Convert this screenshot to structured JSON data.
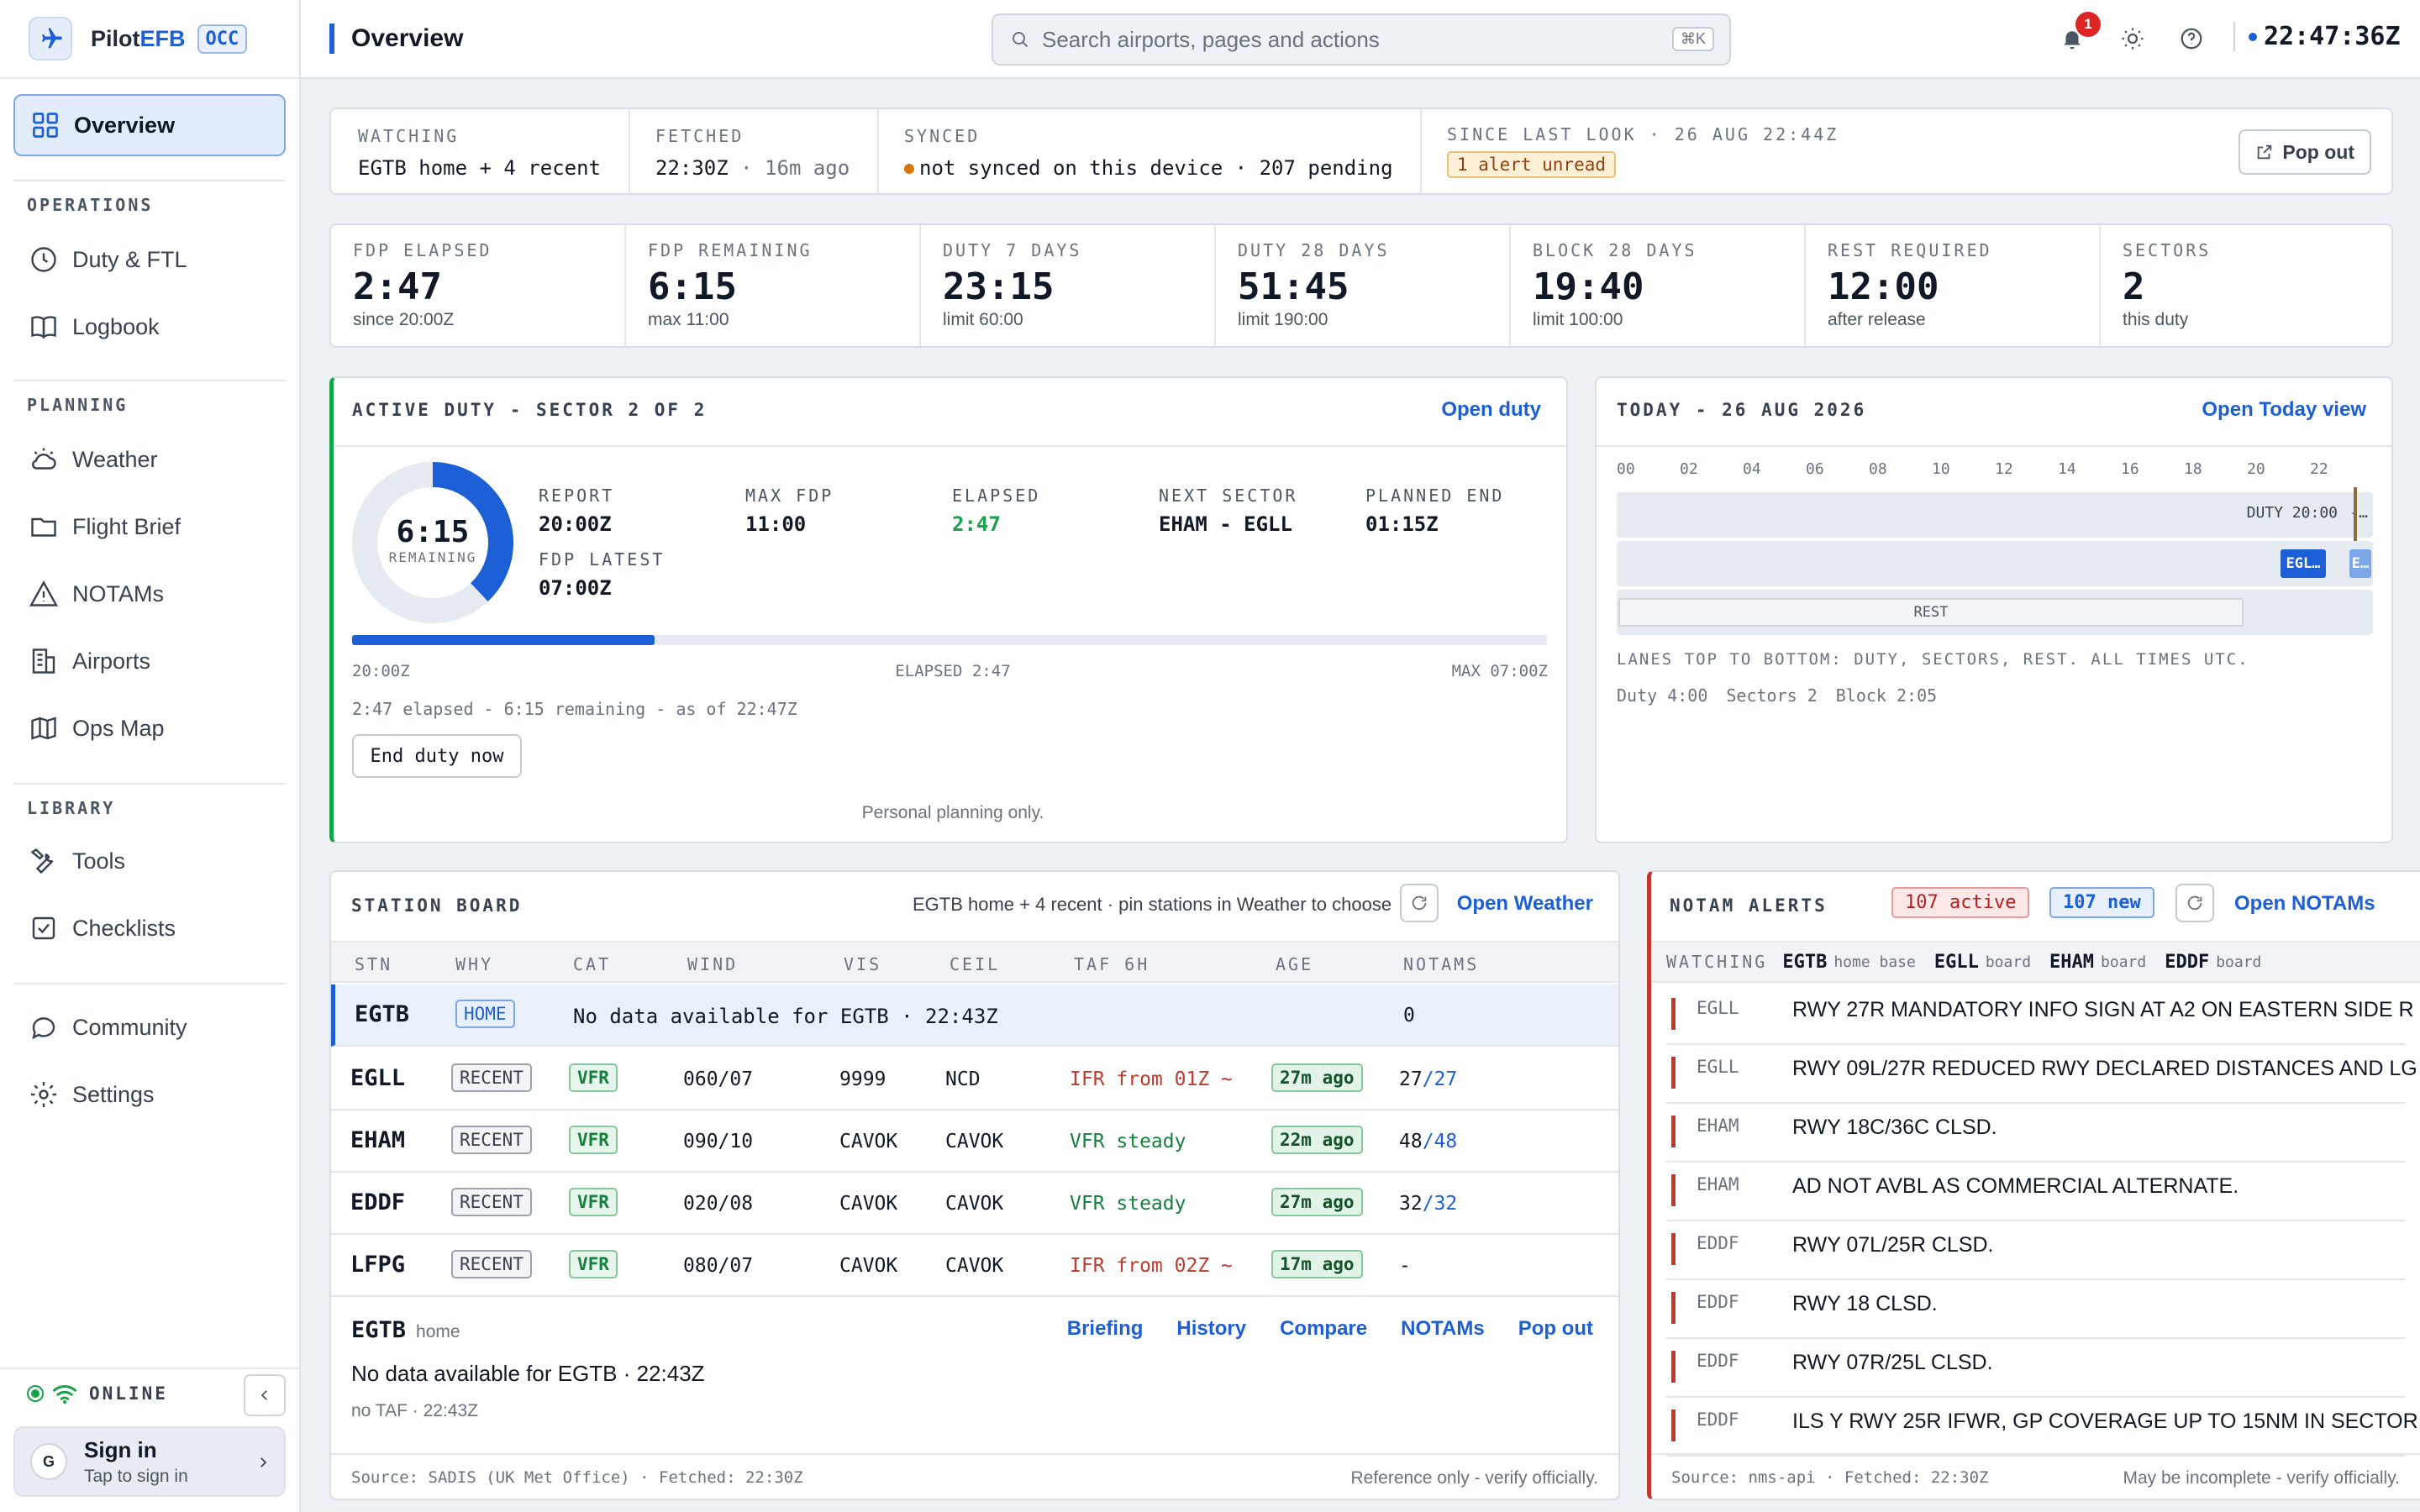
{
  "brand": {
    "name_prefix": "Pilot",
    "name_suffix": "EFB",
    "badge": "OCC"
  },
  "sidebar": {
    "overview": "Overview",
    "sections": {
      "operations": "OPERATIONS",
      "planning": "PLANNING",
      "library": "LIBRARY"
    },
    "items": {
      "duty": "Duty & FTL",
      "logbook": "Logbook",
      "weather": "Weather",
      "flight_brief": "Flight Brief",
      "notams": "NOTAMs",
      "airports": "Airports",
      "ops_map": "Ops Map",
      "tools": "Tools",
      "checklists": "Checklists",
      "community": "Community",
      "settings": "Settings"
    },
    "status": "ONLINE",
    "signin": {
      "avatar": "G",
      "title": "Sign in",
      "subtitle": "Tap to sign in"
    }
  },
  "header": {
    "title": "Overview",
    "search_placeholder": "Search airports, pages and actions",
    "shortcut": "⌘K",
    "notification_count": "1",
    "clock": "22:47:36Z"
  },
  "status_strip": {
    "watching_label": "WATCHING",
    "watching_value": "EGTB home + 4 recent",
    "fetched_label": "FETCHED",
    "fetched_value": "22:30Z",
    "fetched_ago": "· 16m ago",
    "synced_label": "SYNCED",
    "synced_value": "not synced on this device · 207 pending",
    "since_label": "SINCE LAST LOOK · 26 AUG 22:44Z",
    "since_alert": "1 alert unread",
    "popout": "Pop out"
  },
  "metrics": [
    {
      "label": "FDP ELAPSED",
      "value": "2:47",
      "sub": "since 20:00Z"
    },
    {
      "label": "FDP REMAINING",
      "value": "6:15",
      "sub": "max 11:00"
    },
    {
      "label": "DUTY 7 DAYS",
      "value": "23:15",
      "sub": "limit 60:00"
    },
    {
      "label": "DUTY 28 DAYS",
      "value": "51:45",
      "sub": "limit 190:00"
    },
    {
      "label": "BLOCK 28 DAYS",
      "value": "19:40",
      "sub": "limit 100:00"
    },
    {
      "label": "REST REQUIRED",
      "value": "12:00",
      "sub": "after release"
    },
    {
      "label": "SECTORS",
      "value": "2",
      "sub": "this duty"
    }
  ],
  "active_duty": {
    "title": "ACTIVE DUTY - SECTOR 2 OF 2",
    "link": "Open duty",
    "donut_value": "6:15",
    "donut_label": "REMAINING",
    "donut_fraction": 0.38,
    "report_label": "REPORT",
    "report": "20:00Z",
    "max_fdp_label": "MAX FDP",
    "max_fdp": "11:00",
    "elapsed_label": "ELAPSED",
    "elapsed": "2:47",
    "next_label": "NEXT SECTOR",
    "next": "EHAM - EGLL",
    "planned_end_label": "PLANNED END",
    "planned_end": "01:15Z",
    "fdp_latest_label": "FDP LATEST",
    "fdp_latest": "07:00Z",
    "progress_fraction": 0.253,
    "bar_start": "20:00Z",
    "bar_mid": "ELAPSED 2:47",
    "bar_end": "MAX 07:00Z",
    "summary": "2:47 elapsed - 6:15 remaining - as of 22:47Z",
    "end_button": "End duty now",
    "note": "Personal planning only."
  },
  "today": {
    "title": "TODAY - 26 AUG 2026",
    "link": "Open Today view",
    "hours": [
      "00",
      "02",
      "04",
      "06",
      "08",
      "10",
      "12",
      "14",
      "16",
      "18",
      "20",
      "22"
    ],
    "duty_label": "DUTY 20:00",
    "duty_more": "-…",
    "sector1": "EGL…",
    "sector2": "E…",
    "rest_label": "REST",
    "caption": "LANES TOP TO BOTTOM: DUTY, SECTORS, REST. ALL TIMES UTC.",
    "summary_duty": "Duty 4:00",
    "summary_sectors": "Sectors 2",
    "summary_block": "Block 2:05"
  },
  "station_board": {
    "title": "STATION BOARD",
    "hint": "EGTB home + 4 recent · pin stations in Weather to choose",
    "link": "Open Weather",
    "columns": [
      "STN",
      "WHY",
      "CAT",
      "WIND",
      "VIS",
      "CEIL",
      "TAF 6H",
      "AGE",
      "NOTAMS"
    ],
    "home_row": {
      "stn": "EGTB",
      "why": "HOME",
      "message": "No data available for EGTB · 22:43Z",
      "notams": "0"
    },
    "rows": [
      {
        "stn": "EGLL",
        "why": "RECENT",
        "cat": "VFR",
        "wind": "060/07",
        "vis": "9999",
        "ceil": "NCD",
        "taf": "IFR from 01Z ~",
        "taf_color": "#c0392b",
        "age": "27m ago",
        "notams_a": "27",
        "notams_b": "/27"
      },
      {
        "stn": "EHAM",
        "why": "RECENT",
        "cat": "VFR",
        "wind": "090/10",
        "vis": "CAVOK",
        "ceil": "CAVOK",
        "taf": "VFR steady",
        "taf_color": "#15803d",
        "age": "22m ago",
        "notams_a": "48",
        "notams_b": "/48"
      },
      {
        "stn": "EDDF",
        "why": "RECENT",
        "cat": "VFR",
        "wind": "020/08",
        "vis": "CAVOK",
        "ceil": "CAVOK",
        "taf": "VFR steady",
        "taf_color": "#15803d",
        "age": "27m ago",
        "notams_a": "32",
        "notams_b": "/32"
      },
      {
        "stn": "LFPG",
        "why": "RECENT",
        "cat": "VFR",
        "wind": "080/07",
        "vis": "CAVOK",
        "ceil": "CAVOK",
        "taf": "IFR from 02Z ~",
        "taf_color": "#c0392b",
        "age": "17m ago",
        "notams_a": "-",
        "notams_b": ""
      }
    ],
    "detail": {
      "stn": "EGTB",
      "role": "home",
      "links": [
        "Briefing",
        "History",
        "Compare",
        "NOTAMs",
        "Pop out"
      ],
      "message": "No data available for EGTB · 22:43Z",
      "taf": "no TAF · 22:43Z"
    },
    "footer_left": "Source: SADIS (UK Met Office) · Fetched: 22:30Z",
    "footer_right": "Reference only - verify officially."
  },
  "notam_alerts": {
    "title": "NOTAM ALERTS",
    "active": "107 active",
    "new": "107 new",
    "link": "Open NOTAMs",
    "watching_label": "WATCHING",
    "watching": [
      {
        "code": "EGTB",
        "role": "home base"
      },
      {
        "code": "EGLL",
        "role": "board"
      },
      {
        "code": "EHAM",
        "role": "board"
      },
      {
        "code": "EDDF",
        "role": "board"
      }
    ],
    "items": [
      {
        "icao": "EGLL",
        "text": "RWY 27R MANDATORY INFO SIGN AT A2 ON EASTERN SIDE R"
      },
      {
        "icao": "EGLL",
        "text": "RWY 09L/27R REDUCED RWY DECLARED DISTANCES AND LG"
      },
      {
        "icao": "EHAM",
        "text": "RWY 18C/36C CLSD."
      },
      {
        "icao": "EHAM",
        "text": "AD NOT AVBL AS COMMERCIAL ALTERNATE."
      },
      {
        "icao": "EDDF",
        "text": "RWY 07L/25R CLSD."
      },
      {
        "icao": "EDDF",
        "text": "RWY 18 CLSD."
      },
      {
        "icao": "EDDF",
        "text": "RWY 07R/25L CLSD."
      },
      {
        "icao": "EDDF",
        "text": "ILS Y RWY 25R IFWR, GP COVERAGE UP TO 15NM IN SECTOR"
      }
    ],
    "footer_left": "Source: nms-api · Fetched: 22:30Z",
    "footer_right": "May be incomplete - verify officially."
  }
}
